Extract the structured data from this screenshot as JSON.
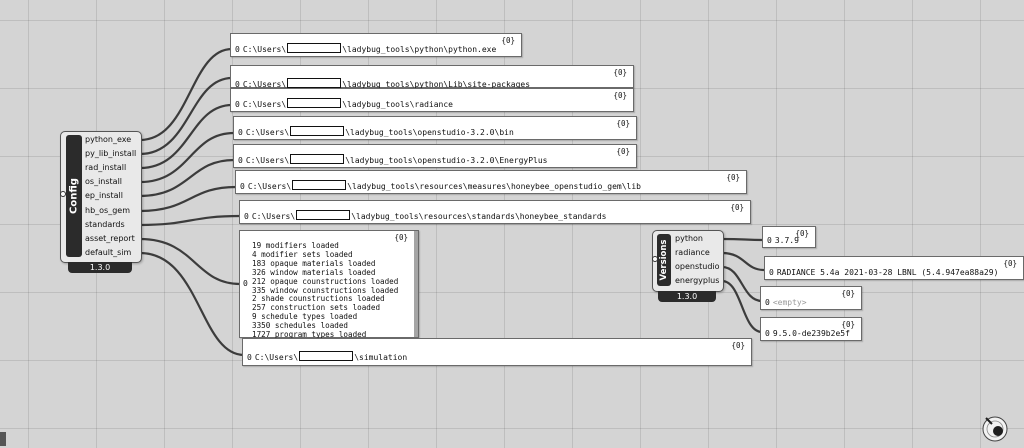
{
  "config": {
    "title": "Config",
    "version": "1.3.0",
    "outputs": [
      "python_exe",
      "py_lib_install",
      "rad_install",
      "os_install",
      "ep_install",
      "hb_os_gem",
      "standards",
      "asset_report",
      "default_sim"
    ]
  },
  "versions": {
    "title": "Versions",
    "version": "1.3.0",
    "outputs": [
      "python",
      "radiance",
      "openstudio",
      "energyplus"
    ]
  },
  "panels": {
    "python_exe": {
      "count": "{0}",
      "index": "0",
      "prefix": "C:\\Users\\",
      "suffix": "\\ladybug_tools\\python\\python.exe"
    },
    "py_lib": {
      "count": "{0}",
      "index": "0",
      "prefix": "C:\\Users\\",
      "suffix": "\\ladybug_tools\\python\\Lib\\site-packages"
    },
    "radiance": {
      "count": "{0}",
      "index": "0",
      "prefix": "C:\\Users\\",
      "suffix": "\\ladybug_tools\\radiance"
    },
    "os_bin": {
      "count": "{0}",
      "index": "0",
      "prefix": "C:\\Users\\",
      "suffix": "\\ladybug_tools\\openstudio-3.2.0\\bin"
    },
    "energyplus": {
      "count": "{0}",
      "index": "0",
      "prefix": "C:\\Users\\",
      "suffix": "\\ladybug_tools\\openstudio-3.2.0\\EnergyPlus"
    },
    "os_gem": {
      "count": "{0}",
      "index": "0",
      "prefix": "C:\\Users\\",
      "suffix": "\\ladybug_tools\\resources\\measures\\honeybee_openstudio_gem\\lib"
    },
    "standards": {
      "count": "{0}",
      "index": "0",
      "prefix": "C:\\Users\\",
      "suffix": "\\ladybug_tools\\resources\\standards\\honeybee_standards"
    },
    "asset_report": {
      "count": "{0}",
      "index": "0",
      "lines": [
        "19 modifiers loaded",
        "4 modifier sets loaded",
        "183 opaque materials loaded",
        "326 window materials loaded",
        "212 opaque counstructions loaded",
        "335 window counstructions loaded",
        "2 shade counstructions loaded",
        "257 construction sets loaded",
        "9 schedule types loaded",
        "3350 schedules loaded",
        "1727 program types loaded"
      ]
    },
    "simulation": {
      "count": "{0}",
      "index": "0",
      "prefix": "C:\\Users\\",
      "suffix": "\\simulation"
    },
    "ver_python": {
      "count": "{0}",
      "index": "0",
      "value": "3.7.9"
    },
    "ver_radiance": {
      "count": "{0}",
      "index": "0",
      "value": "RADIANCE 5.4a 2021-03-28 LBNL (5.4.947ea88a29)"
    },
    "ver_openstudio": {
      "count": "{0}",
      "index": "0",
      "value": "<empty>"
    },
    "ver_energyplus": {
      "count": "{0}",
      "index": "0",
      "value": "9.5.0-de239b2e5f"
    }
  },
  "colors": {
    "canvas": "#d4d4d4",
    "component_tab": "#2b2b2b",
    "wire": "#3c3c3c"
  }
}
